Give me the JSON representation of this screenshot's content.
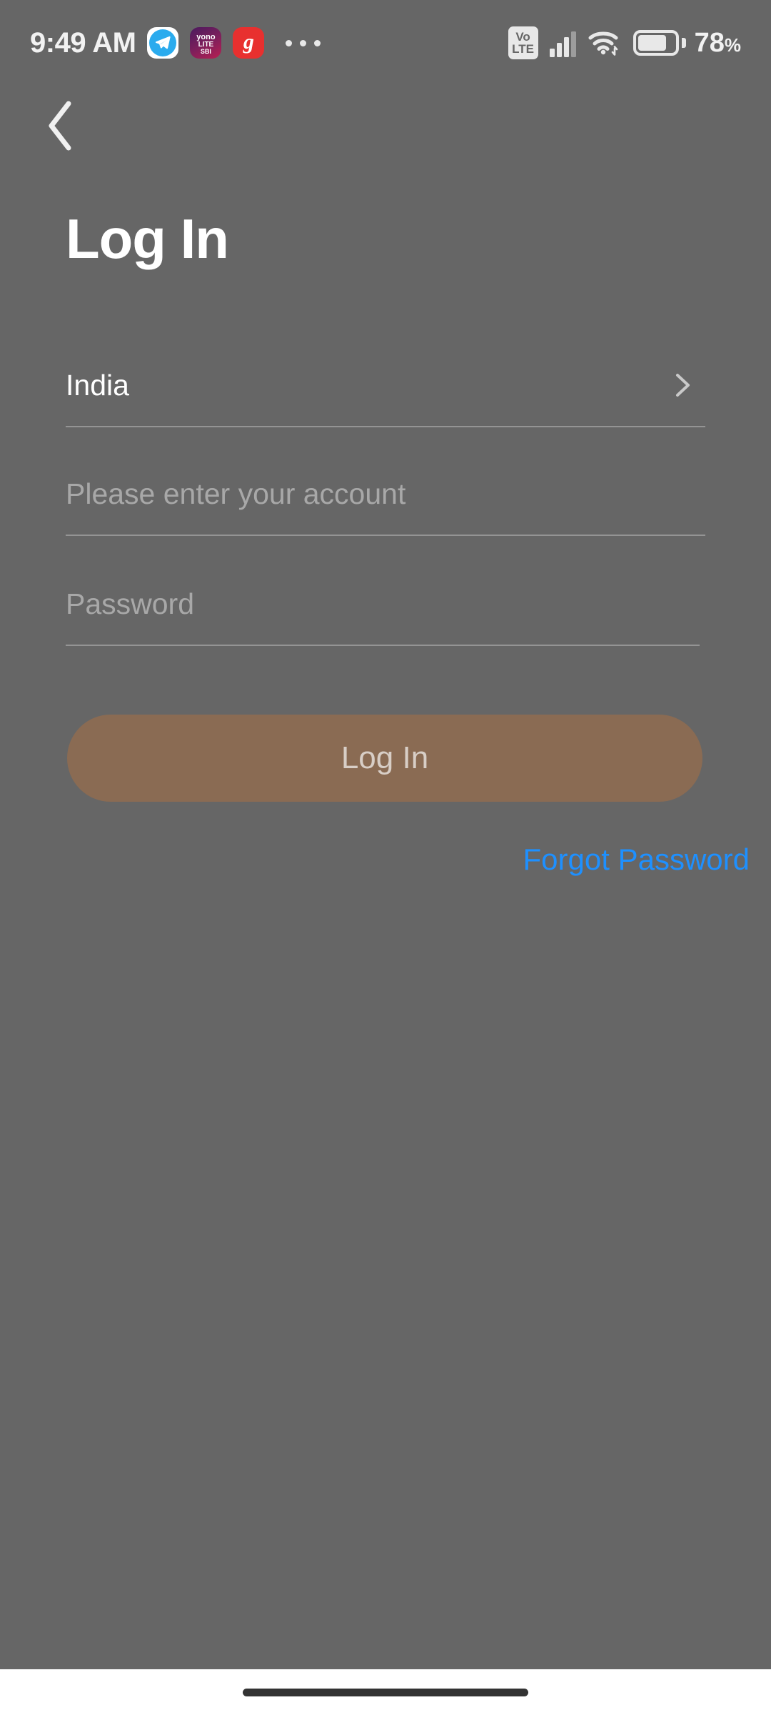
{
  "status_bar": {
    "clock": "9:49 AM",
    "app_icons": [
      {
        "name": "telegram",
        "label": ""
      },
      {
        "name": "yono-lite-sbi",
        "line1": "yono",
        "line2": "LITE",
        "line3": "SBI"
      },
      {
        "name": "groww",
        "label": "g"
      }
    ],
    "overflow_indicator": "•••",
    "volte": {
      "line1": "Vo",
      "line2": "LTE"
    },
    "signal_icon": "signal-bars-icon",
    "wifi_icon": "wifi-icon",
    "battery": {
      "level_percent": 78,
      "label": "78",
      "percent_sign": "%"
    }
  },
  "navigation": {
    "back_icon": "chevron-left-icon"
  },
  "page": {
    "title": "Log In"
  },
  "form": {
    "country": {
      "label": "India",
      "chevron_icon": "chevron-right-icon"
    },
    "account": {
      "value": "",
      "placeholder": "Please enter your account"
    },
    "password": {
      "value": "",
      "placeholder": "Password"
    }
  },
  "actions": {
    "login_label": "Log In",
    "forgot_password_label": "Forgot Password"
  },
  "colors": {
    "screen_dim_overlay": "#666666",
    "login_button": "#8a6b53",
    "login_button_text": "#d8cec6",
    "link_blue": "#1E90FF",
    "title_white": "#ffffff",
    "placeholder_gray": "#a8a8a8",
    "divider": "rgba(255,255,255,0.30)",
    "nav_bar": "#ffffff",
    "gesture_pill": "#333333"
  },
  "system": {
    "gesture_pill": "home-indicator"
  }
}
